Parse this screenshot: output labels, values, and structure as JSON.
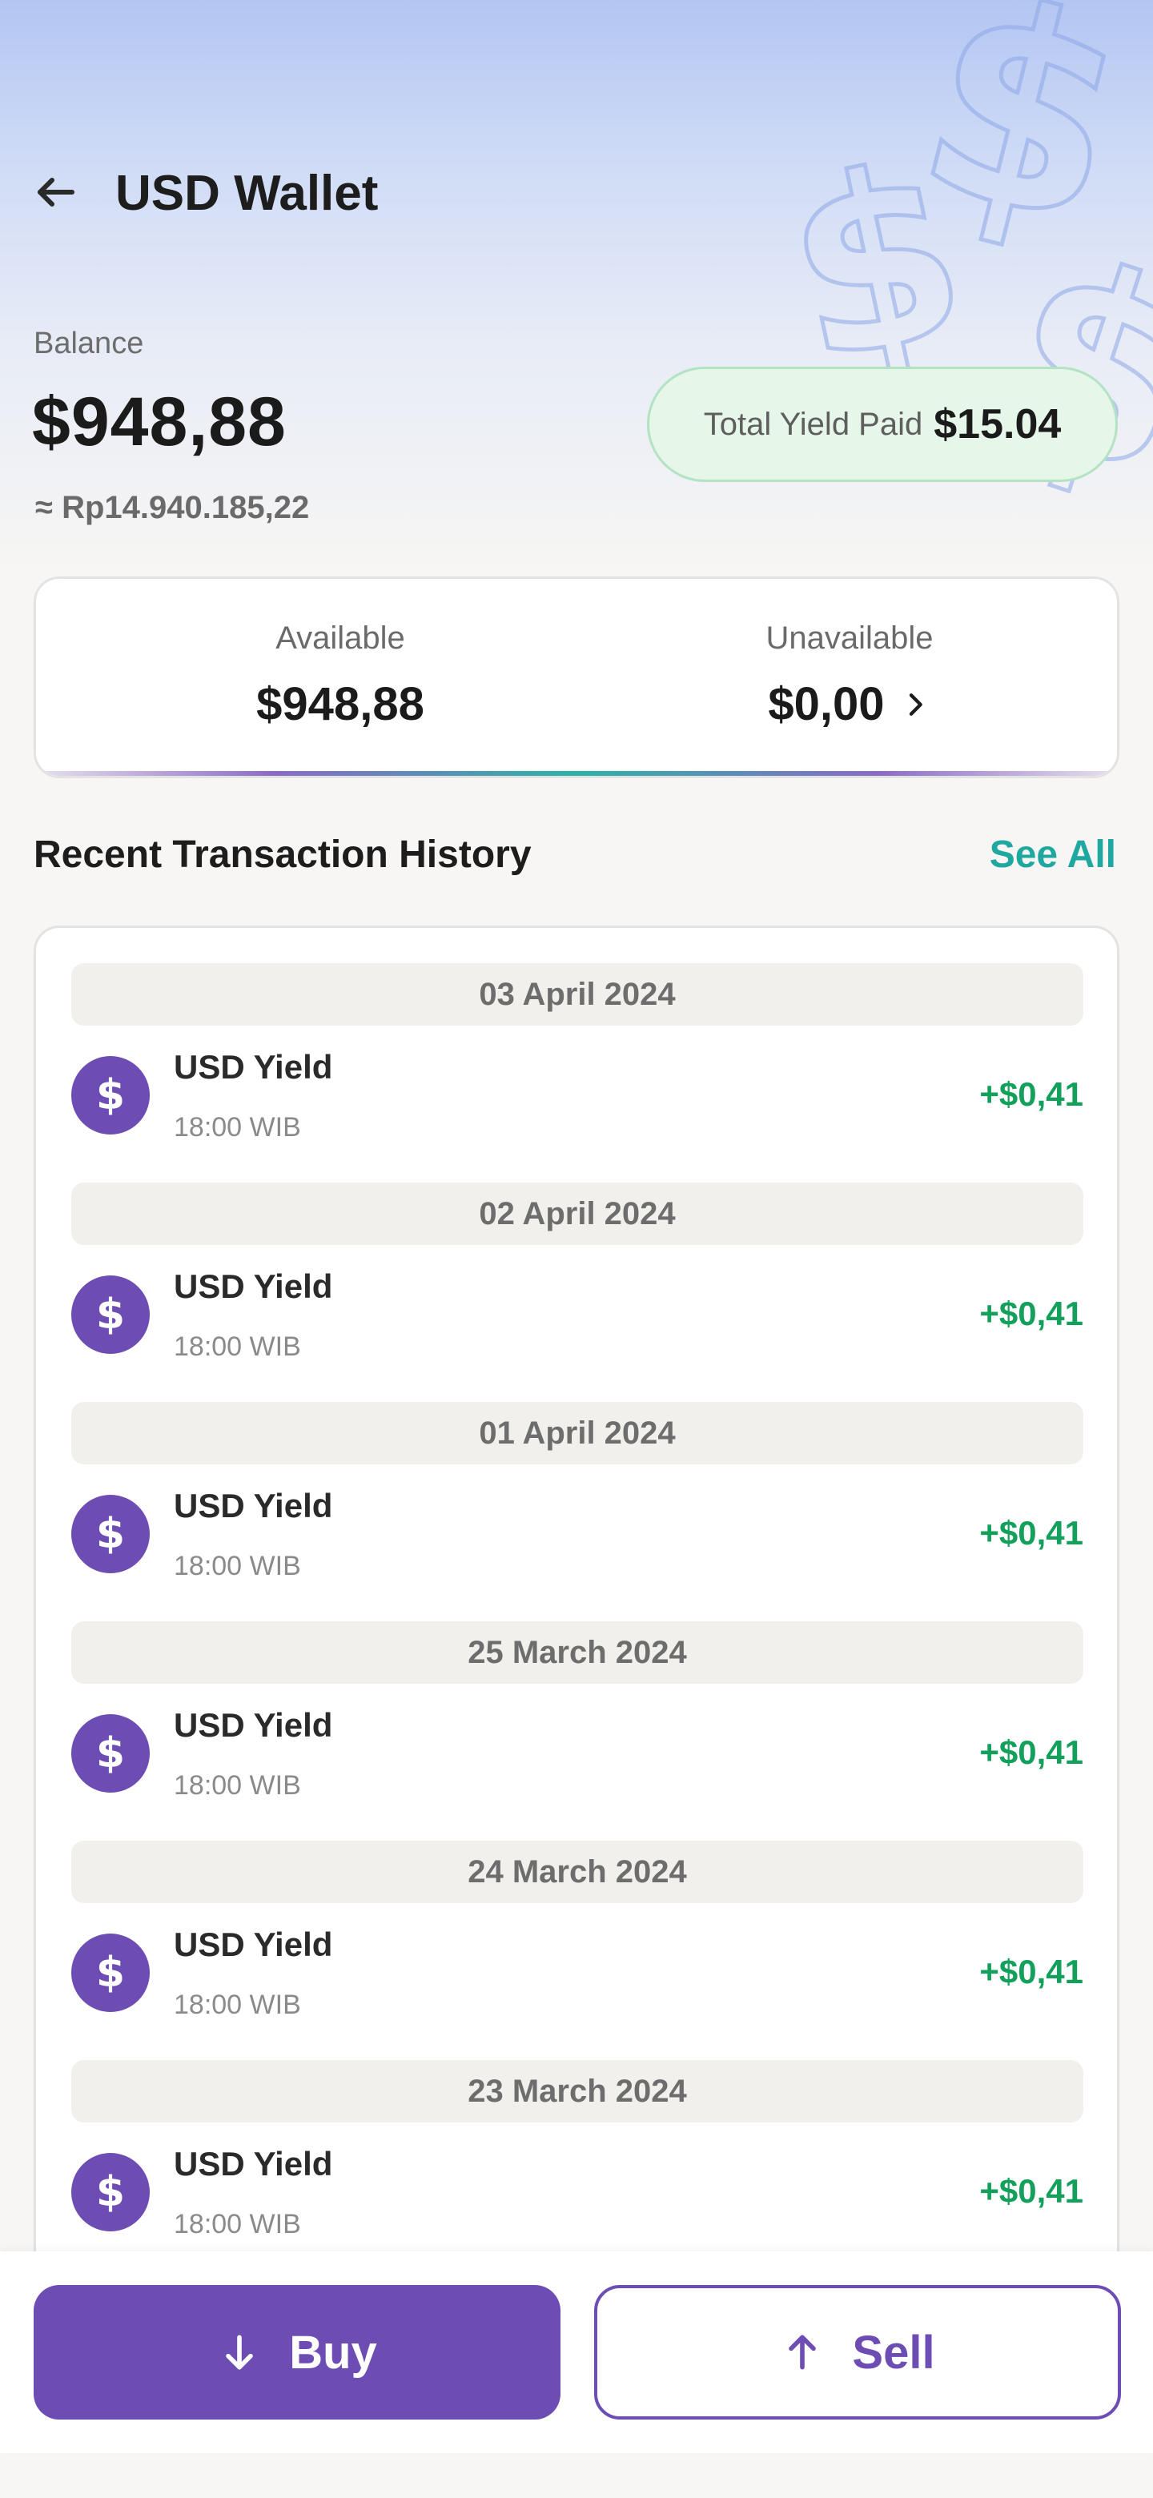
{
  "header": {
    "title": "USD Wallet"
  },
  "balance": {
    "label": "Balance",
    "value": "$948,88",
    "idr_equivalent": "≈ Rp14.940.185,22",
    "total_yield_label": "Total Yield Paid",
    "total_yield_value": "$15.04"
  },
  "availability": {
    "available_label": "Available",
    "available_value": "$948,88",
    "unavailable_label": "Unavailable",
    "unavailable_value": "$0,00"
  },
  "history": {
    "title": "Recent Transaction History",
    "see_all": "See All",
    "groups": [
      {
        "date": "03 April 2024",
        "name": "USD Yield",
        "time": "18:00 WIB",
        "amount": "+$0,41"
      },
      {
        "date": "02 April 2024",
        "name": "USD Yield",
        "time": "18:00 WIB",
        "amount": "+$0,41"
      },
      {
        "date": "01 April 2024",
        "name": "USD Yield",
        "time": "18:00 WIB",
        "amount": "+$0,41"
      },
      {
        "date": "25 March 2024",
        "name": "USD Yield",
        "time": "18:00 WIB",
        "amount": "+$0,41"
      },
      {
        "date": "24 March 2024",
        "name": "USD Yield",
        "time": "18:00 WIB",
        "amount": "+$0,41"
      },
      {
        "date": "23 March 2024",
        "name": "USD Yield",
        "time": "18:00 WIB",
        "amount": "+$0,41"
      }
    ]
  },
  "actions": {
    "buy_label": "Buy",
    "sell_label": "Sell"
  },
  "icons": {
    "back": "arrow-left-icon",
    "chevron": "chevron-right-icon",
    "tx": "dollar-icon",
    "buy": "arrow-down-icon",
    "sell": "arrow-up-icon"
  },
  "colors": {
    "brand": "#6d4cb3",
    "accent": "#1ea89f",
    "positive": "#12a05a",
    "yield_bg": "#e6f7ea"
  }
}
